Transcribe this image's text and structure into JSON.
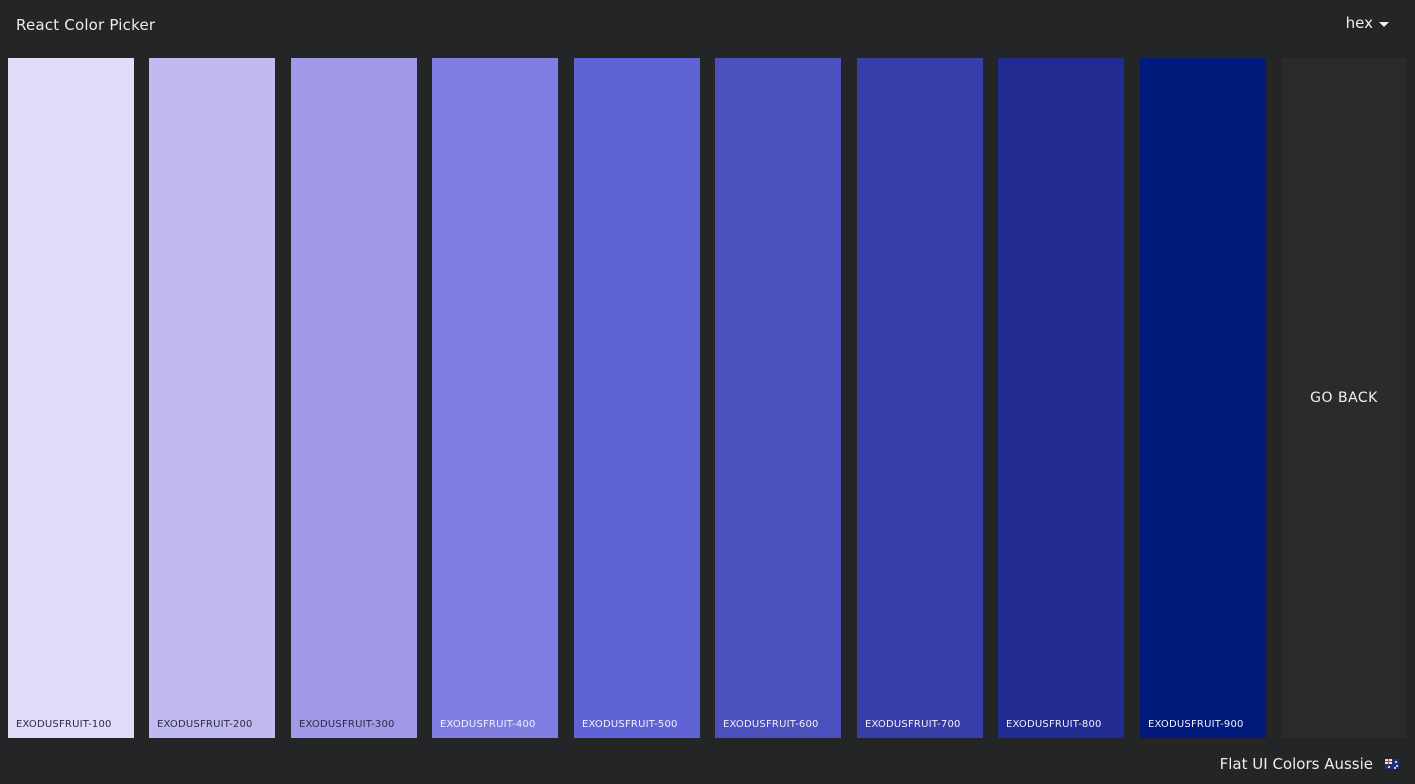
{
  "navbar": {
    "brand": "React Color Picker",
    "format_label": "hex"
  },
  "palette": {
    "swatches": [
      {
        "label": "EXODUSFRUIT-100",
        "color": "#e0dcf9",
        "text_color": "#2b2b45"
      },
      {
        "label": "EXODUSFRUIT-200",
        "color": "#c1baf0",
        "text_color": "#2b2b45"
      },
      {
        "label": "EXODUSFRUIT-300",
        "color": "#a19ae9",
        "text_color": "#2b2b45"
      },
      {
        "label": "EXODUSFRUIT-400",
        "color": "#7f7de2",
        "text_color": "#f0f0ff"
      },
      {
        "label": "EXODUSFRUIT-500",
        "color": "#6063d6",
        "text_color": "#f0f0ff"
      },
      {
        "label": "EXODUSFRUIT-600",
        "color": "#4b50bd",
        "text_color": "#f0f0ff"
      },
      {
        "label": "EXODUSFRUIT-700",
        "color": "#373ea7",
        "text_color": "#f0f0ff"
      },
      {
        "label": "EXODUSFRUIT-800",
        "color": "#222b91",
        "text_color": "#f0f0ff"
      },
      {
        "label": "EXODUSFRUIT-900",
        "color": "#001a7b",
        "text_color": "#f0f0ff"
      }
    ],
    "go_back_label": "GO BACK"
  },
  "footer": {
    "palette_name": "Flat UI Colors Aussie",
    "emoji_icon": "australia-flag-icon"
  }
}
